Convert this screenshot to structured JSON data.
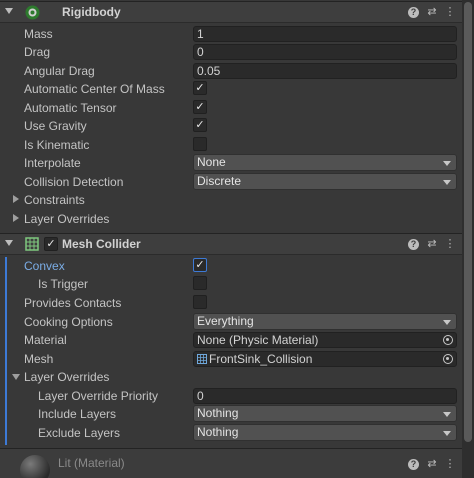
{
  "rigidbody": {
    "title": "Rigidbody",
    "rows": {
      "mass": {
        "label": "Mass",
        "value": "1"
      },
      "drag": {
        "label": "Drag",
        "value": "0"
      },
      "angular_drag": {
        "label": "Angular Drag",
        "value": "0.05"
      },
      "auto_center": {
        "label": "Automatic Center Of Mass",
        "checked": true
      },
      "auto_tensor": {
        "label": "Automatic Tensor",
        "checked": true
      },
      "use_gravity": {
        "label": "Use Gravity",
        "checked": true
      },
      "is_kinematic": {
        "label": "Is Kinematic",
        "checked": false
      },
      "interpolate": {
        "label": "Interpolate",
        "value": "None"
      },
      "collision_detection": {
        "label": "Collision Detection",
        "value": "Discrete"
      },
      "constraints": {
        "label": "Constraints"
      },
      "layer_overrides": {
        "label": "Layer Overrides"
      }
    }
  },
  "mesh_collider": {
    "title": "Mesh Collider",
    "enabled": true,
    "rows": {
      "convex": {
        "label": "Convex",
        "checked": true
      },
      "is_trigger": {
        "label": "Is Trigger",
        "checked": false
      },
      "provides_contacts": {
        "label": "Provides Contacts",
        "checked": false
      },
      "cooking_options": {
        "label": "Cooking Options",
        "value": "Everything"
      },
      "material": {
        "label": "Material",
        "value": "None (Physic Material)"
      },
      "mesh": {
        "label": "Mesh",
        "value": "FrontSink_Collision"
      },
      "layer_overrides": {
        "label": "Layer Overrides"
      },
      "priority": {
        "label": "Layer Override Priority",
        "value": "0"
      },
      "include_layers": {
        "label": "Include Layers",
        "value": "Nothing"
      },
      "exclude_layers": {
        "label": "Exclude Layers",
        "value": "Nothing"
      }
    }
  },
  "material_section": {
    "title": "Lit (Material)"
  },
  "icons": {
    "check_glyph": "✓",
    "help_glyph": "?",
    "preset_glyph": "⇄",
    "menu_glyph": "⋮"
  },
  "colors": {
    "accent": "#3d7ad6",
    "label_highlight": "#7bade6"
  }
}
